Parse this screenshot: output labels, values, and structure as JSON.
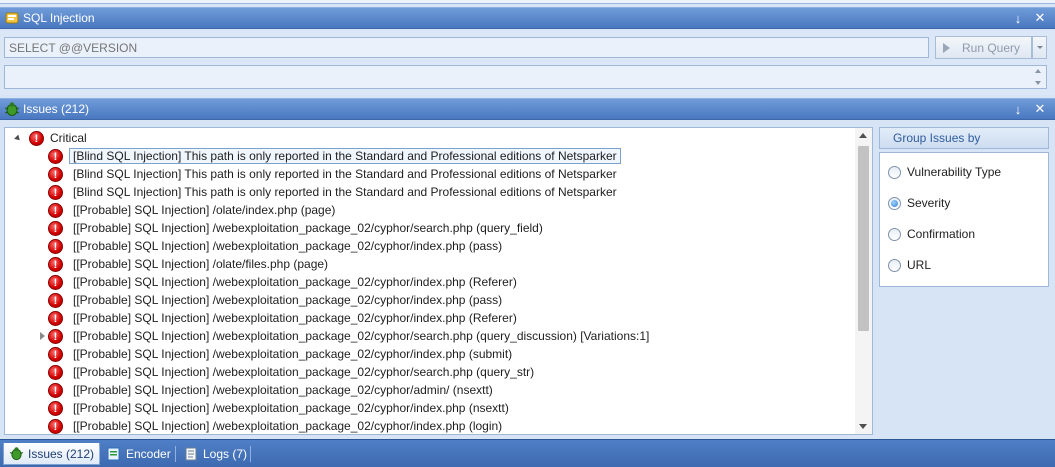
{
  "sql_panel": {
    "title": "SQL Injection",
    "query_placeholder": "SELECT @@VERSION",
    "run_button_label": "Run Query",
    "pin_glyph": "↓",
    "close_glyph": "✕",
    "icon": "sql-injection-icon"
  },
  "issues_panel": {
    "title": "Issues (212)",
    "pin_glyph": "↓",
    "close_glyph": "✕",
    "icon": "bug-icon",
    "group_label": "Critical",
    "rows": [
      "[Blind SQL Injection] This path is only reported in the Standard and Professional editions of Netsparker",
      "[Blind SQL Injection] This path is only reported in the Standard and Professional editions of Netsparker",
      "[Blind SQL Injection] This path is only reported in the Standard and Professional editions of Netsparker",
      "[[Probable] SQL Injection] /olate/index.php (page)",
      "[[Probable] SQL Injection] /webexploitation_package_02/cyphor/search.php (query_field)",
      "[[Probable] SQL Injection] /webexploitation_package_02/cyphor/index.php (pass)",
      "[[Probable] SQL Injection] /olate/files.php (page)",
      "[[Probable] SQL Injection] /webexploitation_package_02/cyphor/index.php (Referer)",
      "[[Probable] SQL Injection] /webexploitation_package_02/cyphor/index.php (pass)",
      "[[Probable] SQL Injection] /webexploitation_package_02/cyphor/index.php (Referer)",
      "[[Probable] SQL Injection] /webexploitation_package_02/cyphor/search.php (query_discussion) [Variations:1]",
      "[[Probable] SQL Injection] /webexploitation_package_02/cyphor/index.php (submit)",
      "[[Probable] SQL Injection] /webexploitation_package_02/cyphor/search.php (query_str)",
      "[[Probable] SQL Injection] /webexploitation_package_02/cyphor/admin/ (nsextt)",
      "[[Probable] SQL Injection] /webexploitation_package_02/cyphor/index.php (nsextt)",
      "[[Probable] SQL Injection] /webexploitation_package_02/cyphor/index.php (login)"
    ],
    "selected_index": 0,
    "expandable_index": 10,
    "severity_icon_glyph": "!"
  },
  "group_issues": {
    "header": "Group Issues by",
    "options": [
      "Vulnerability Type",
      "Severity",
      "Confirmation",
      "URL"
    ],
    "selected": "Severity"
  },
  "bottom_tabs": [
    {
      "label": "Issues (212)",
      "icon": "bug-icon",
      "active": true
    },
    {
      "label": "Encoder",
      "icon": "encoder-icon",
      "active": false
    },
    {
      "label": "Logs (7)",
      "icon": "logs-icon",
      "active": false
    }
  ],
  "colors": {
    "titlebar": "#5a88cc",
    "critical": "#d10000",
    "group_header_text": "#2f5e9b"
  }
}
